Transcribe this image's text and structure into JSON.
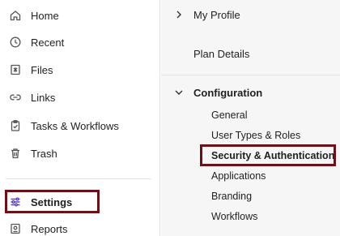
{
  "sidebar": {
    "items": [
      {
        "label": "Home",
        "icon": "home-icon"
      },
      {
        "label": "Recent",
        "icon": "clock-icon"
      },
      {
        "label": "Files",
        "icon": "files-icon"
      },
      {
        "label": "Links",
        "icon": "link-icon"
      },
      {
        "label": "Tasks & Workflows",
        "icon": "clipboard-icon"
      },
      {
        "label": "Trash",
        "icon": "trash-icon"
      },
      {
        "label": "Settings",
        "icon": "sliders-icon"
      },
      {
        "label": "Reports",
        "icon": "reports-icon"
      }
    ],
    "active_item": "Settings"
  },
  "settings_panel": {
    "my_profile": "My Profile",
    "plan_details": "Plan Details",
    "configuration": {
      "label": "Configuration",
      "items": [
        "General",
        "User Types & Roles",
        "Security & Authentication",
        "Applications",
        "Branding",
        "Workflows"
      ],
      "active_item": "Security & Authentication"
    }
  },
  "colors": {
    "highlight_border": "#6e1018",
    "panel_background": "#f6f6f6",
    "settings_icon_accent": "#5b3fc4"
  }
}
